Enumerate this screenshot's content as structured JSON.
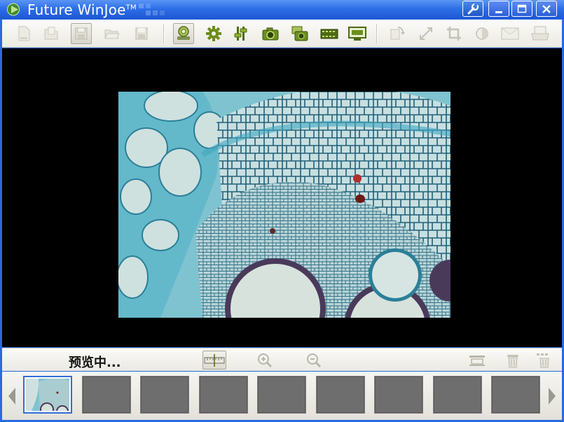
{
  "window": {
    "title": "Future WinJoe",
    "trademark": "TM"
  },
  "icons": {
    "app_logo": "play-logo-icon",
    "settings": "wrench-icon",
    "minimize": "minimize-icon",
    "maximize": "maximize-icon",
    "close": "close-icon"
  },
  "toolbar": {
    "groups": [
      [
        "new-file-icon",
        "open-folder-icon",
        "save-copy-icon",
        "open-icon",
        "save-icon"
      ],
      [
        "camera-preview-icon",
        "gear-icon",
        "adjust-sliders-icon",
        "snapshot-camera-icon",
        "multi-capture-icon",
        "video-record-icon",
        "monitor-icon"
      ],
      [
        "rotate-icon",
        "resize-icon",
        "crop-icon",
        "brightness-icon",
        "image-icon",
        "export-icon"
      ]
    ]
  },
  "status": {
    "text": "预览中..."
  },
  "statusbar_icons": [
    "ruler-icon",
    "zoom-in-icon",
    "zoom-out-icon",
    "fit-window-icon",
    "trash-icon",
    "delete-all-icon"
  ],
  "thumbnails": {
    "count": 9,
    "selected_index": 0
  },
  "colors": {
    "titlebar": "#2e6fe8",
    "accent_green": "#6c8f1c",
    "stain_cyan": "#56b6c8",
    "selected_border": "#2f6fd9"
  }
}
